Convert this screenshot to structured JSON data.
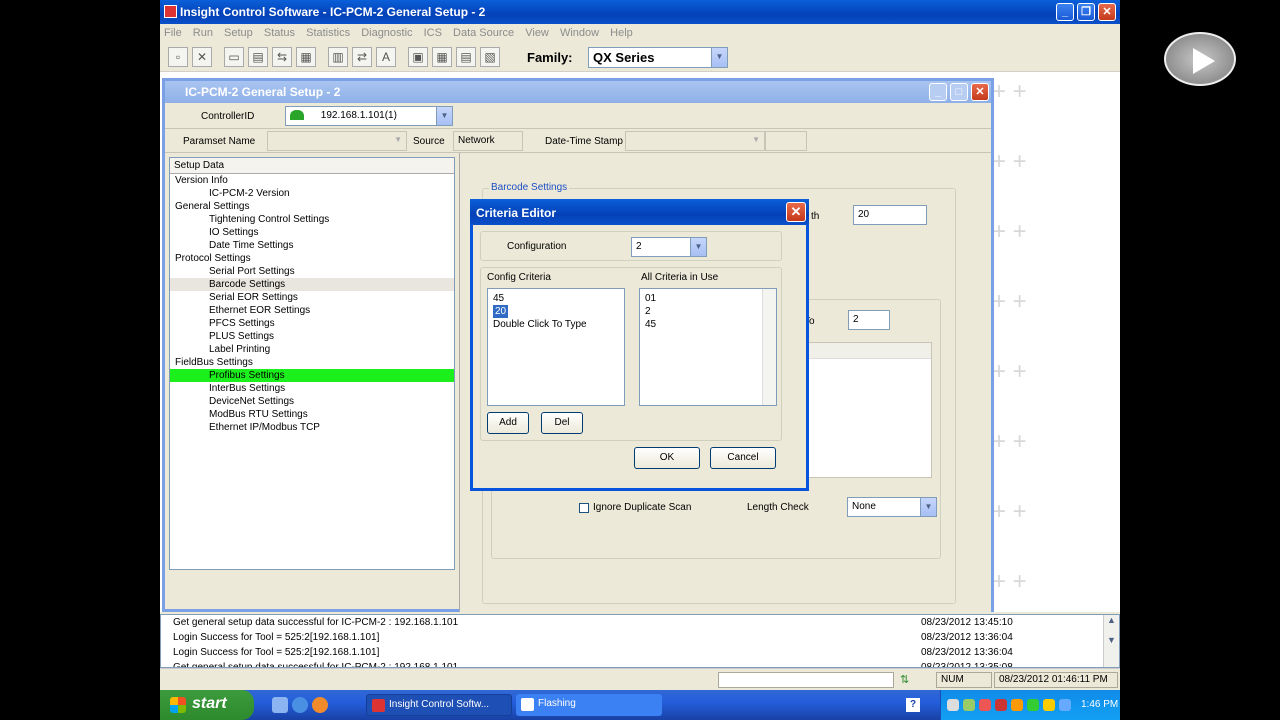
{
  "main_window": {
    "title": "Insight Control Software - IC-PCM-2 General Setup - 2",
    "menu": [
      "File",
      "Run",
      "Setup",
      "Status",
      "Statistics",
      "Diagnostic",
      "ICS",
      "Data Source",
      "View",
      "Window",
      "Help"
    ],
    "family_label": "Family:",
    "family_value": "QX Series"
  },
  "child_window": {
    "title": "IC-PCM-2 General Setup - 2",
    "controller_id_label": "ControllerID",
    "controller_id_value": "192.168.1.101(1)",
    "paramset_name_label": "Paramset Name",
    "source_label": "Source",
    "source_value": "Network",
    "datetime_label": "Date-Time Stamp"
  },
  "tree": {
    "header": "Setup Data",
    "items": [
      {
        "label": "Version Info",
        "level": 0
      },
      {
        "label": "IC-PCM-2 Version",
        "level": 1
      },
      {
        "label": "General Settings",
        "level": 0
      },
      {
        "label": "Tightening Control Settings",
        "level": 1
      },
      {
        "label": "IO Settings",
        "level": 1
      },
      {
        "label": "Date Time Settings",
        "level": 1
      },
      {
        "label": "Protocol Settings",
        "level": 0
      },
      {
        "label": "Serial Port Settings",
        "level": 1
      },
      {
        "label": "Barcode Settings",
        "level": 1
      },
      {
        "label": "Serial EOR Settings",
        "level": 1
      },
      {
        "label": "Ethernet EOR Settings",
        "level": 1
      },
      {
        "label": "PFCS Settings",
        "level": 1
      },
      {
        "label": "PLUS Settings",
        "level": 1
      },
      {
        "label": "Label Printing",
        "level": 1
      },
      {
        "label": "FieldBus Settings",
        "level": 0
      },
      {
        "label": "Profibus Settings",
        "level": 1
      },
      {
        "label": "InterBus Settings",
        "level": 1
      },
      {
        "label": "DeviceNet Settings",
        "level": 1
      },
      {
        "label": "ModBus RTU Settings",
        "level": 1
      },
      {
        "label": "Ethernet IP/Modbus TCP",
        "level": 1
      }
    ]
  },
  "barcode_panel": {
    "group_label": "Barcode Settings",
    "length_suffix": "th",
    "length_value": "20",
    "to_label": "To",
    "to_value": "2",
    "ignore_duplicate_label": "Ignore Duplicate Scan",
    "length_check_label": "Length Check",
    "length_check_value": "None"
  },
  "criteria_dialog": {
    "title": "Criteria Editor",
    "configuration_label": "Configuration",
    "configuration_value": "2",
    "config_criteria_label": "Config Criteria",
    "config_criteria_items": [
      "45",
      "20",
      "Double Click To Type"
    ],
    "all_criteria_label": "All Criteria in Use",
    "all_criteria_items": [
      "01",
      "2",
      "45"
    ],
    "add_label": "Add",
    "del_label": "Del",
    "ok_label": "OK",
    "cancel_label": "Cancel"
  },
  "log": [
    {
      "msg": "Get general setup data successful for IC-PCM-2 : 192.168.1.101",
      "ts": "08/23/2012 13:45:10"
    },
    {
      "msg": "Login Success for Tool = 525:2[192.168.1.101]",
      "ts": "08/23/2012 13:36:04"
    },
    {
      "msg": "Login Success for Tool = 525:2[192.168.1.101]",
      "ts": "08/23/2012 13:36:04"
    },
    {
      "msg": "Get general setup data successful for IC-PCM-2 : 192.168.1.101",
      "ts": "08/23/2012 13:35:08"
    }
  ],
  "statusbar": {
    "num": "NUM",
    "datetime": "08/23/2012 01:46:11 PM"
  },
  "taskbar": {
    "start": "start",
    "items": [
      "Insight Control Softw...",
      "Flashing"
    ],
    "clock": "1:46 PM"
  }
}
